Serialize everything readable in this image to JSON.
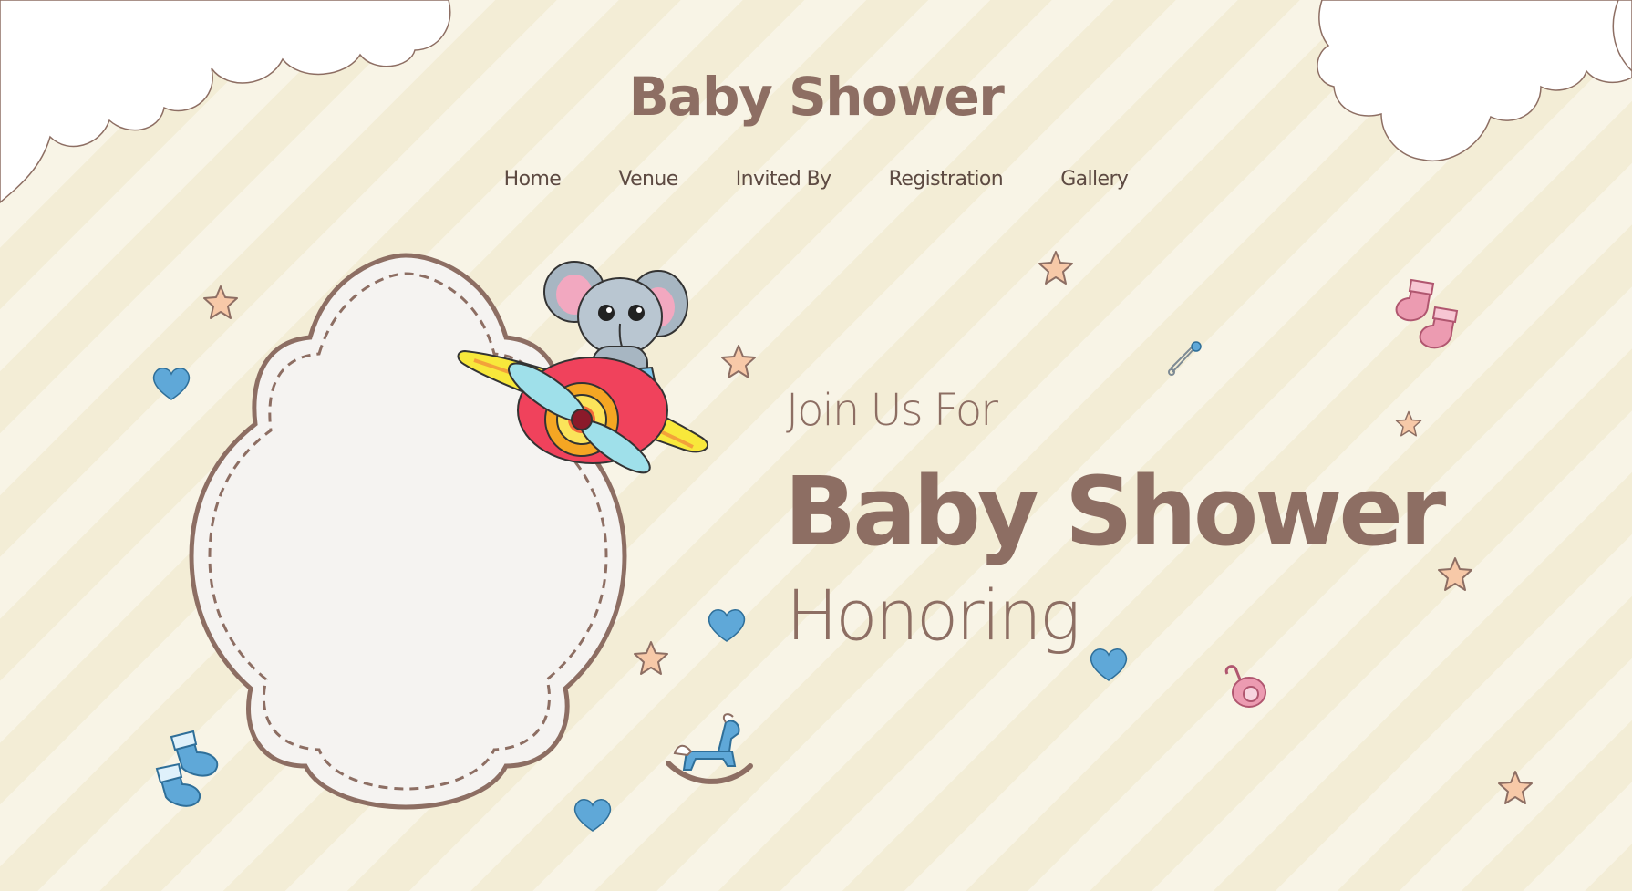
{
  "header": {
    "site_title": "Baby Shower"
  },
  "nav": {
    "items": [
      {
        "label": "Home"
      },
      {
        "label": "Venue"
      },
      {
        "label": "Invited By"
      },
      {
        "label": "Registration"
      },
      {
        "label": "Gallery"
      }
    ]
  },
  "hero": {
    "intro": "Join Us For",
    "title": "Baby Shower",
    "honoring": "Honoring"
  },
  "colors": {
    "background": "#f5f0dc",
    "stripe": "#f8f4e6",
    "title_brown": "#8d6e63",
    "nav_text": "#5d4a42",
    "frame_fill": "#f5f3f1",
    "heart_blue": "#5fa8d8",
    "star_peach": "#f7c9a8",
    "sock_pink": "#ec9bb1"
  },
  "icons": [
    "cloud-icon",
    "star-icon",
    "heart-icon",
    "elephant-airplane-icon",
    "rocking-horse-icon",
    "baby-socks-icon",
    "pacifier-icon",
    "safety-pin-icon"
  ]
}
